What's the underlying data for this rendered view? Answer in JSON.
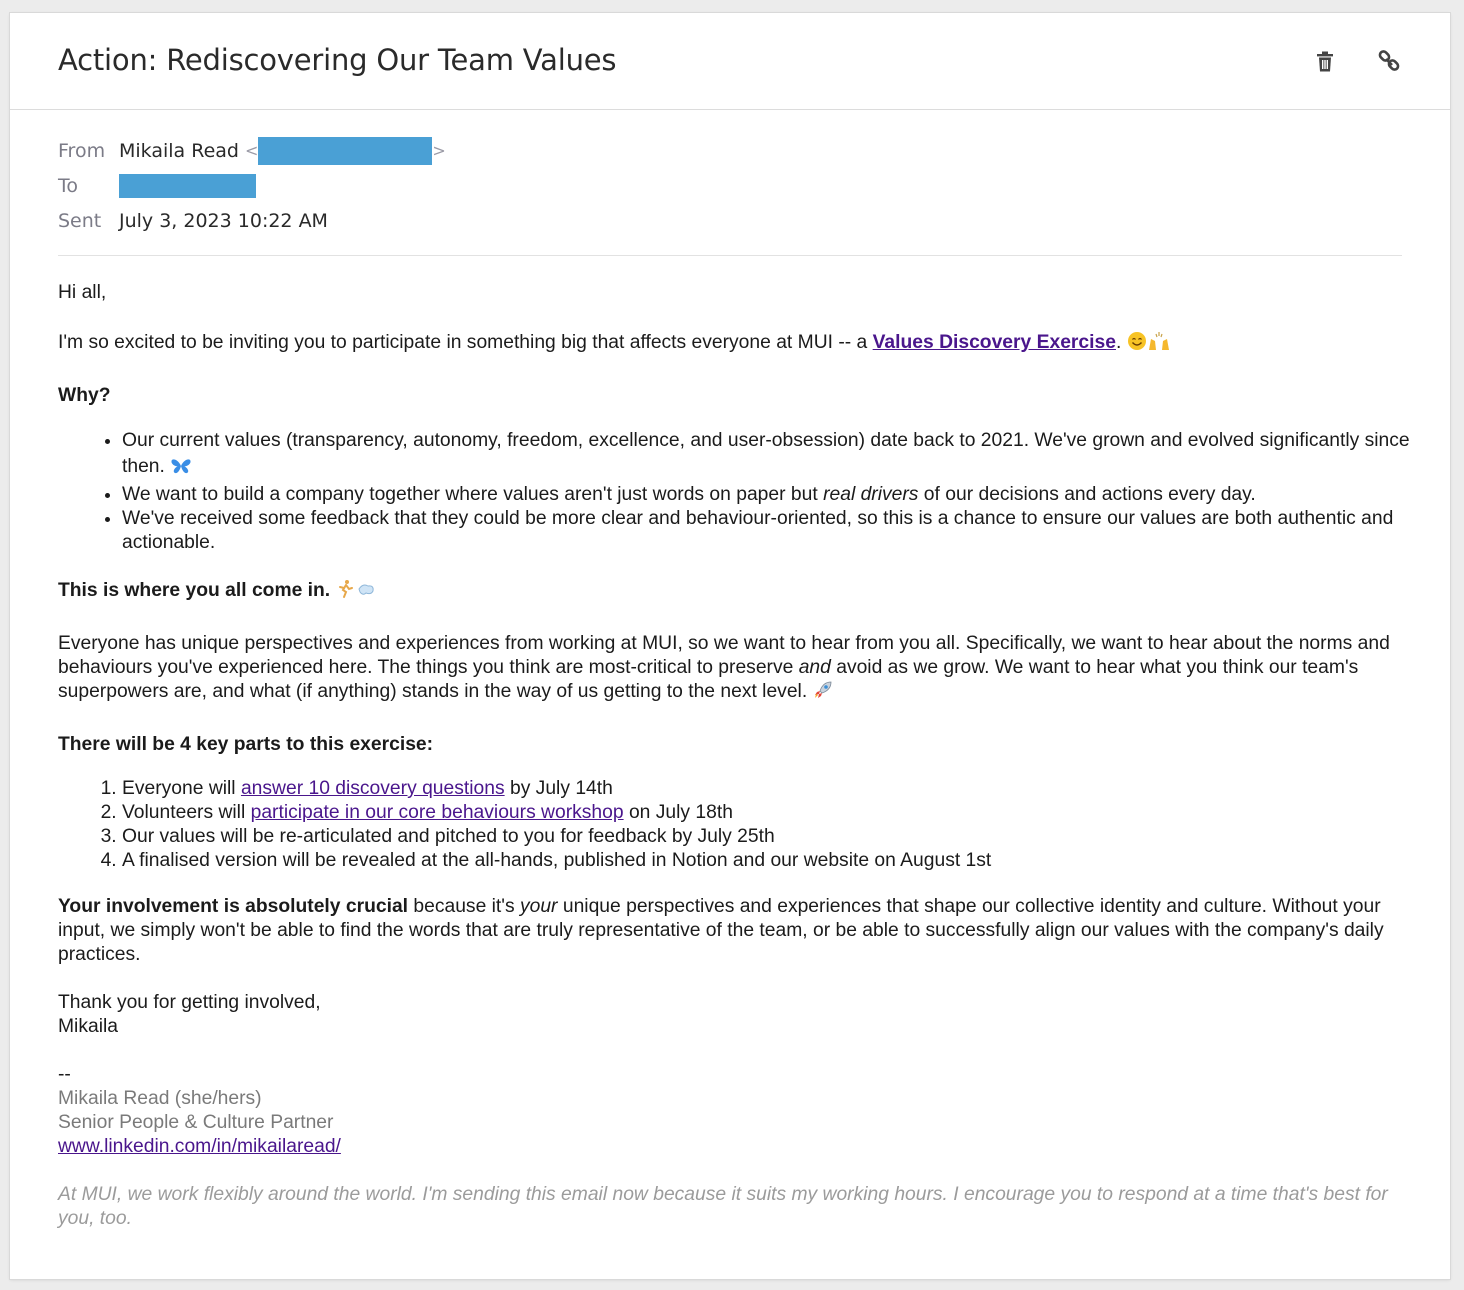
{
  "email": {
    "subject": "Action: Rediscovering Our Team Values",
    "from_label": "From",
    "from_name": "Mikaila Read",
    "from_open": "<",
    "from_close": ">",
    "to_label": "To",
    "sent_label": "Sent",
    "sent_value": "July 3, 2023 10:22 AM"
  },
  "body": {
    "greeting": "Hi all,",
    "intro_pre": "I'm so excited to be inviting you to participate in something big that affects everyone at MUI -- a ",
    "intro_link": "Values Discovery Exercise",
    "intro_post": ".",
    "why_heading": "Why?",
    "why_1": "Our current values (transparency, autonomy, freedom, excellence, and user-obsession) date back to 2021. We've grown and evolved significantly since then.",
    "why_2_pre": "We want to build a company together where values aren't just words on paper but ",
    "why_2_em": "real drivers",
    "why_2_post": " of our decisions and actions every day.",
    "why_3": "We've received some feedback that they could be more clear and behaviour-oriented, so this is a chance to ensure our values are both authentic and actionable.",
    "come_in": "This is where you all come in.",
    "para_pre": "Everyone has unique perspectives and experiences from working at MUI, so we want to hear from you all. Specifically, we want to hear about the norms and behaviours you've experienced here. The things you think are most-critical to preserve ",
    "para_em": "and",
    "para_post": " avoid as we grow. We want to hear what you think our team's superpowers are, and what (if anything) stands in the way of us getting to the next level.",
    "parts_heading": "There will be 4 key parts to this exercise:",
    "step_1_pre": "Everyone will ",
    "step_1_link": "answer 10 discovery questions",
    "step_1_post": " by July 14th",
    "step_2_pre": "Volunteers will ",
    "step_2_link": "participate in our core behaviours workshop",
    "step_2_post": " on July 18th",
    "step_3": "Our values will be re-articulated and pitched to you for feedback by July 25th",
    "step_4": "A finalised version will be revealed at the all-hands, published in Notion and our website on August 1st",
    "crucial_bold": "Your involvement is absolutely crucial",
    "crucial_pre": " because it's ",
    "crucial_em": "your",
    "crucial_post": " unique perspectives and experiences that shape our collective identity and culture. Without your input, we simply won't be able to find the words that are truly representative of the team, or be able to successfully align our values with the company's daily practices.",
    "thanks": "Thank you for getting involved,",
    "signoff": "Mikaila",
    "sig_dashes": "--",
    "sig_name": "Mikaila Read (she/hers)",
    "sig_title": "Senior People & Culture Partner",
    "sig_link": "www.linkedin.com/in/mikailaread/",
    "footer_note": "At MUI, we work flexibly around the world. I'm sending this email now because it suits my working hours. I encourage you to respond at a time that's best for you, too."
  },
  "icons": [
    "trash-icon",
    "link-icon"
  ],
  "colors": {
    "link": "#4a168c",
    "redaction": "#4aa0d5"
  }
}
